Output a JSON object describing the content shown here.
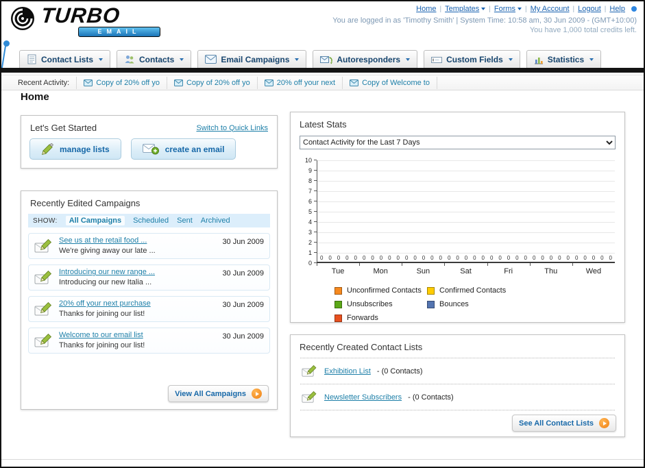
{
  "brand": {
    "name_top": "TURBO",
    "name_bottom": "EMAIL"
  },
  "header": {
    "links": [
      {
        "label": "Home",
        "dropdown": false
      },
      {
        "label": "Templates",
        "dropdown": true
      },
      {
        "label": "Forms",
        "dropdown": true
      },
      {
        "label": "My Account",
        "dropdown": false
      },
      {
        "label": "Logout",
        "dropdown": false
      },
      {
        "label": "Help",
        "dropdown": false
      }
    ],
    "status_line1": "You are logged in as 'Timothy Smith' | System Time: 10:58 am, 30 Jun 2009 - (GMT+10:00)",
    "status_line2": "You have 1,000 total credits left."
  },
  "nav": {
    "tabs": [
      {
        "label": "Contact Lists"
      },
      {
        "label": "Contacts"
      },
      {
        "label": "Email Campaigns"
      },
      {
        "label": "Autoresponders"
      },
      {
        "label": "Custom Fields"
      },
      {
        "label": "Statistics"
      }
    ]
  },
  "recent_activity": {
    "label": "Recent Activity:",
    "items": [
      "Copy of 20% off yo",
      "Copy of 20% off yo",
      "20% off your next",
      "Copy of Welcome to"
    ]
  },
  "page_title": "Home",
  "get_started": {
    "title": "Let's Get Started",
    "switch_link": "Switch to Quick Links",
    "manage_lists_label": "manage lists",
    "create_email_label": "create an email"
  },
  "campaigns": {
    "title": "Recently Edited Campaigns",
    "show_label": "SHOW:",
    "filters": [
      "All Campaigns",
      "Scheduled",
      "Sent",
      "Archived"
    ],
    "active_filter": "All Campaigns",
    "items": [
      {
        "title": "See us at the retail food ...",
        "subtitle": "We're giving away our late ...",
        "date": "30 Jun 2009"
      },
      {
        "title": "Introducing our new range ...",
        "subtitle": "Introducing our new Italia ...",
        "date": "30 Jun 2009"
      },
      {
        "title": "20% off your next purchase",
        "subtitle": "Thanks for joining our list!",
        "date": "30 Jun 2009"
      },
      {
        "title": "Welcome to our email list",
        "subtitle": "Thanks for joining our list!",
        "date": "30 Jun 2009"
      }
    ],
    "view_all_label": "View All Campaigns"
  },
  "stats": {
    "title": "Latest Stats",
    "dropdown_value": "Contact Activity for the Last 7 Days"
  },
  "chart_data": {
    "type": "bar",
    "title": "Contact Activity for the Last 7 Days",
    "xlabel": "",
    "ylabel": "",
    "categories": [
      "Tue",
      "Mon",
      "Sun",
      "Sat",
      "Fri",
      "Thu",
      "Wed"
    ],
    "series": [
      {
        "name": "Unconfirmed Contacts",
        "color": "#F6891F",
        "values": [
          0,
          0,
          0,
          0,
          0,
          0,
          0
        ]
      },
      {
        "name": "Confirmed Contacts",
        "color": "#FFCC00",
        "values": [
          0,
          0,
          0,
          0,
          0,
          0,
          0
        ]
      },
      {
        "name": "Unsubscribes",
        "color": "#5BA818",
        "values": [
          0,
          0,
          0,
          0,
          0,
          0,
          0
        ]
      },
      {
        "name": "Bounces",
        "color": "#5374B0",
        "values": [
          0,
          0,
          0,
          0,
          0,
          0,
          0
        ]
      },
      {
        "name": "Forwards",
        "color": "#E8501F",
        "values": [
          0,
          0,
          0,
          0,
          0,
          0,
          0
        ]
      }
    ],
    "ylim": [
      0,
      10
    ],
    "yticks": [
      10,
      9,
      8,
      7,
      6,
      5,
      4,
      3,
      2,
      1,
      0
    ],
    "grid": true,
    "legend_position": "bottom"
  },
  "contact_lists": {
    "title": "Recently Created Contact Lists",
    "items": [
      {
        "name": "Exhibition List",
        "detail": "- (0 Contacts)"
      },
      {
        "name": "Newsletter Subscribers",
        "detail": "- (0 Contacts)"
      }
    ],
    "see_all_label": "See All Contact Lists"
  }
}
